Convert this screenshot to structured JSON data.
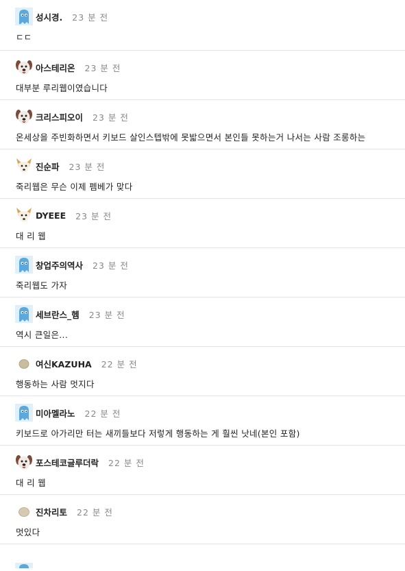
{
  "comments": [
    {
      "nickname": "성시경.",
      "time": "23 분 전",
      "text": "ㄷㄷ",
      "avatar": "ghost-avatar-blue"
    },
    {
      "nickname": "아스테리온",
      "time": "23 분 전",
      "text": "대부분 루리웹이였습니다",
      "avatar": "dog-avatar-brown"
    },
    {
      "nickname": "크리스피오이",
      "time": "23 분 전",
      "text": "온세상을 주빈화하면서 키보드 살인스텝밖에 못밟으면서 본인들 못하는거 나서는 사람 조롱하는 ",
      "avatar": "dog-avatar-brown"
    },
    {
      "nickname": "진순파",
      "time": "23 분 전",
      "text": "죽리웹은 무슨 이제 펨베가 맞다",
      "avatar": "fox-avatar"
    },
    {
      "nickname": "DYEEE",
      "time": "23 분 전",
      "text": "대 리 웹",
      "avatar": "fox-avatar"
    },
    {
      "nickname": "창업주의역사",
      "time": "23 분 전",
      "text": "죽리웹도 가자",
      "avatar": "ghost-avatar-blue"
    },
    {
      "nickname": "세브란스_헴",
      "time": "23 분 전",
      "text": "역시 큰일은...",
      "avatar": "ghost-avatar-blue"
    },
    {
      "nickname": "여신KAZUHA",
      "time": "22 분 전",
      "text": "행동하는 사람 멋지다",
      "avatar": "egg-avatar"
    },
    {
      "nickname": "미아멜라노",
      "time": "22 분 전",
      "text": "키보드로 아가리만 터는 새끼들보다 저렇게 행동하는 게 훨씬 낫네(본인 포함)",
      "avatar": "ghost-avatar-blue"
    },
    {
      "nickname": "포스테코글루더락",
      "time": "22 분 전",
      "text": "대 리 웹",
      "avatar": "dog-avatar-brown"
    },
    {
      "nickname": "진차리토",
      "time": "22 분 전",
      "text": "멋있다",
      "avatar": "egg-avatar"
    }
  ],
  "colors": {
    "nickname": "#222222",
    "time": "#888888",
    "divider": "#e6e6e6",
    "ghost_blue": "#5aa8dc",
    "dog_brown": "#7a4a3a"
  }
}
